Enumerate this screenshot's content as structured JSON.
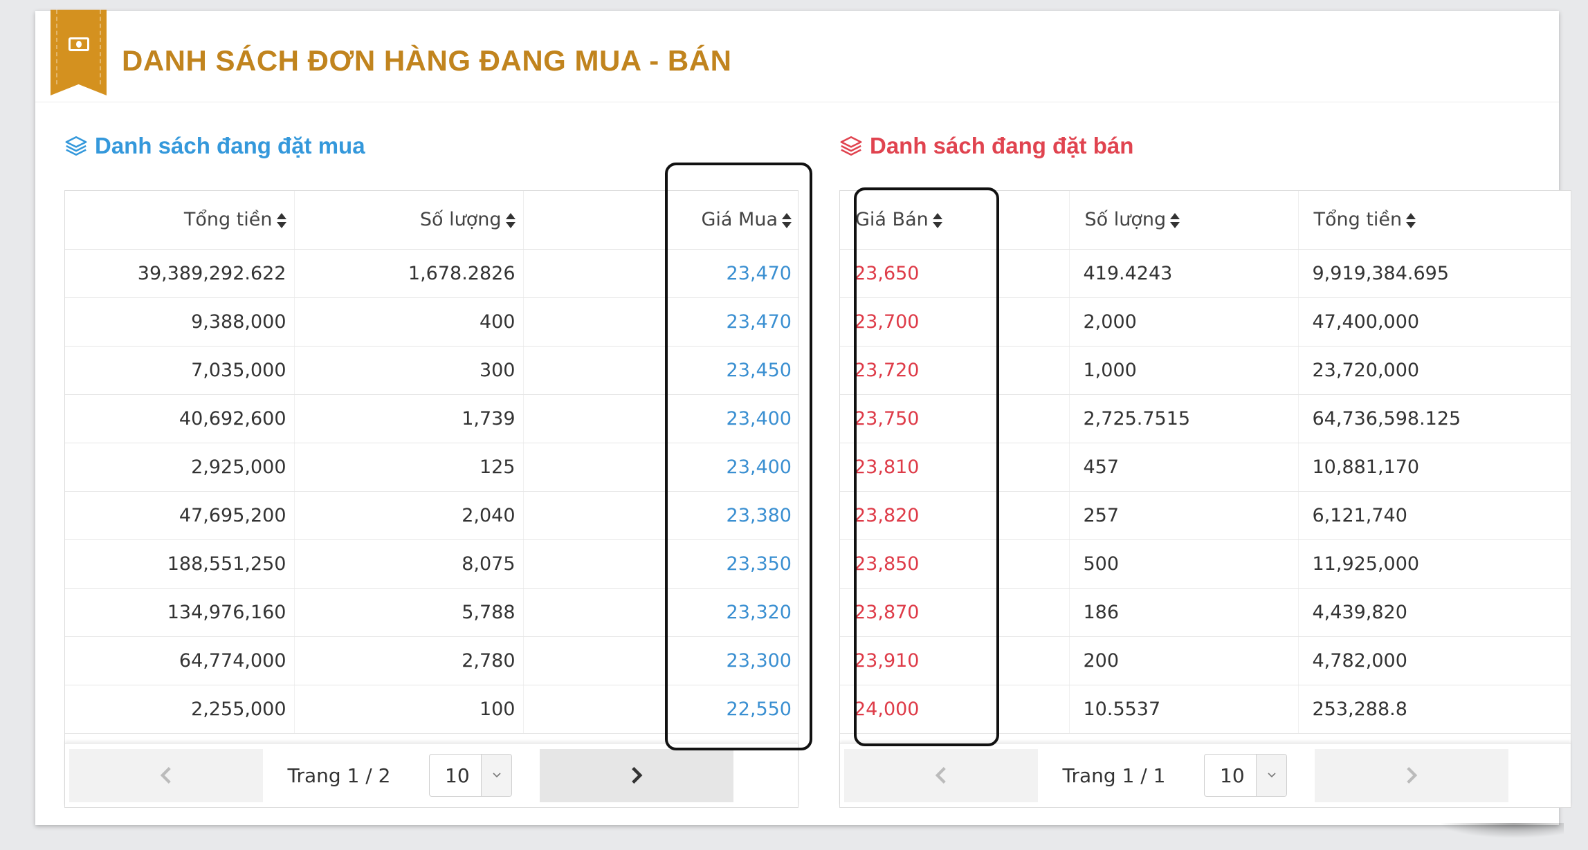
{
  "header": {
    "title": "DANH SÁCH ĐƠN HÀNG ĐANG MUA - BÁN"
  },
  "buy": {
    "title": "Danh sách đang đặt mua",
    "columns": [
      "Tổng tiền",
      "Số lượng",
      "Giá Mua"
    ],
    "rows": [
      [
        "39,389,292.622",
        "1,678.2826",
        "23,470"
      ],
      [
        "9,388,000",
        "400",
        "23,470"
      ],
      [
        "7,035,000",
        "300",
        "23,450"
      ],
      [
        "40,692,600",
        "1,739",
        "23,400"
      ],
      [
        "2,925,000",
        "125",
        "23,400"
      ],
      [
        "47,695,200",
        "2,040",
        "23,380"
      ],
      [
        "188,551,250",
        "8,075",
        "23,350"
      ],
      [
        "134,976,160",
        "5,788",
        "23,320"
      ],
      [
        "64,774,000",
        "2,780",
        "23,300"
      ],
      [
        "2,255,000",
        "100",
        "22,550"
      ]
    ],
    "pager": {
      "label": "Trang 1 / 2",
      "page_size": "10"
    }
  },
  "sell": {
    "title": "Danh sách đang đặt bán",
    "columns": [
      "Giá Bán",
      "Số lượng",
      "Tổng tiền"
    ],
    "rows": [
      [
        "23,650",
        "419.4243",
        "9,919,384.695"
      ],
      [
        "23,700",
        "2,000",
        "47,400,000"
      ],
      [
        "23,720",
        "1,000",
        "23,720,000"
      ],
      [
        "23,750",
        "2,725.7515",
        "64,736,598.125"
      ],
      [
        "23,810",
        "457",
        "10,881,170"
      ],
      [
        "23,820",
        "257",
        "6,121,740"
      ],
      [
        "23,850",
        "500",
        "11,925,000"
      ],
      [
        "23,870",
        "186",
        "4,439,820"
      ],
      [
        "23,910",
        "200",
        "4,782,000"
      ],
      [
        "24,000",
        "10.5537",
        "253,288.8"
      ]
    ],
    "pager": {
      "label": "Trang 1 / 1",
      "page_size": "10"
    }
  },
  "colors": {
    "accent_gold": "#c1841e",
    "buy_blue": "#3498db",
    "sell_red": "#e0434f"
  },
  "icons": [
    "money-icon",
    "layers-icon",
    "sort-icon",
    "chevron-left-icon",
    "chevron-right-icon",
    "chevron-down-icon"
  ]
}
